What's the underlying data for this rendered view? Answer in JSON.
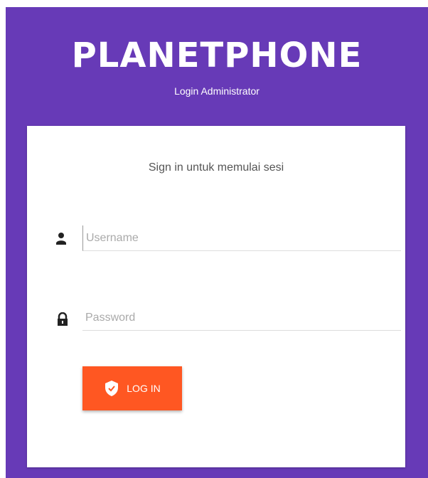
{
  "header": {
    "brand": "PLANETPHONE",
    "subtitle": "Login Administrator"
  },
  "card": {
    "message": "Sign in untuk memulai sesi",
    "username": {
      "placeholder": "Username",
      "value": "",
      "icon": "person-icon"
    },
    "password": {
      "placeholder": "Password",
      "value": "",
      "icon": "lock-icon"
    },
    "login_button": {
      "label": "LOG IN",
      "icon": "shield-icon"
    }
  },
  "colors": {
    "background": "#673AB7",
    "card": "#FFFFFF",
    "button": "#FF5722"
  }
}
